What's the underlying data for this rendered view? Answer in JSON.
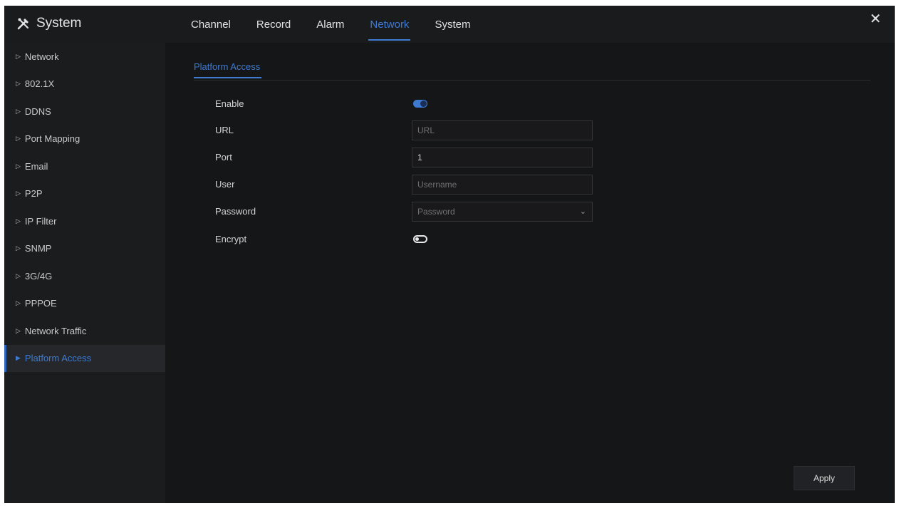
{
  "app": {
    "title": "System",
    "icon": "tools-icon"
  },
  "tabs": [
    {
      "label": "Channel",
      "active": false
    },
    {
      "label": "Record",
      "active": false
    },
    {
      "label": "Alarm",
      "active": false
    },
    {
      "label": "Network",
      "active": true
    },
    {
      "label": "System",
      "active": false
    }
  ],
  "close_icon": "close-icon",
  "sidebar": {
    "items": [
      {
        "label": "Network"
      },
      {
        "label": "802.1X"
      },
      {
        "label": "DDNS"
      },
      {
        "label": "Port Mapping"
      },
      {
        "label": "Email"
      },
      {
        "label": "P2P"
      },
      {
        "label": "IP Filter"
      },
      {
        "label": "SNMP"
      },
      {
        "label": "3G/4G"
      },
      {
        "label": "PPPOE"
      },
      {
        "label": "Network Traffic"
      },
      {
        "label": "Platform Access",
        "active": true
      }
    ]
  },
  "subtab": {
    "label": "Platform Access"
  },
  "form": {
    "enable": {
      "label": "Enable",
      "on": true
    },
    "url": {
      "label": "URL",
      "value": "",
      "placeholder": "URL"
    },
    "port": {
      "label": "Port",
      "value": "1"
    },
    "user": {
      "label": "User",
      "value": "",
      "placeholder": "Username"
    },
    "password": {
      "label": "Password",
      "value": "",
      "placeholder": "Password"
    },
    "encrypt": {
      "label": "Encrypt",
      "on": false
    }
  },
  "apply_label": "Apply",
  "colors": {
    "accent": "#3f7ad1",
    "background": "#151618",
    "sidebar": "#1b1c1e"
  }
}
